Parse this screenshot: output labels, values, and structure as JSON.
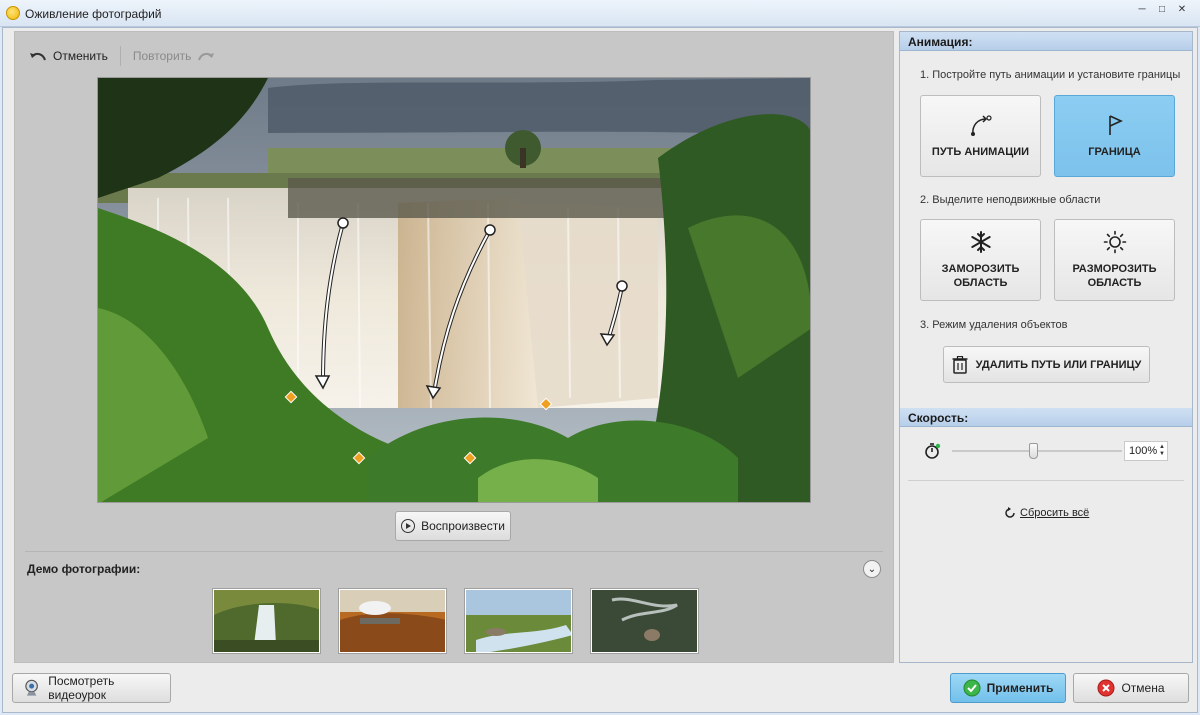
{
  "window": {
    "title": "Оживление фотографий",
    "controls": [
      "minimize-icon",
      "maximize-icon",
      "close-icon"
    ]
  },
  "toolbar": {
    "undo_label": "Отменить",
    "redo_label": "Повторить"
  },
  "player": {
    "play_label": "Воспроизвести"
  },
  "demo": {
    "label": "Демо фотографии:",
    "thumbnails": [
      "waterfall-thumbnail",
      "train-bridge-thumbnail",
      "river-thumbnail",
      "smoke-thumbnail"
    ]
  },
  "animation": {
    "header": "Анимация:",
    "step1": "1. Постройте путь анимации и установите границы",
    "path_button": "ПУТЬ АНИМАЦИИ",
    "border_button": "ГРАНИЦА",
    "step2": "2. Выделите неподвижные области",
    "freeze_button": "ЗАМОРОЗИТЬ ОБЛАСТЬ",
    "unfreeze_button": "РАЗМОРОЗИТЬ ОБЛАСТЬ",
    "step3": "3. Режим удаления объектов",
    "delete_button": "УДАЛИТЬ ПУТЬ ИЛИ ГРАНИЦУ",
    "active_tool": "border"
  },
  "speed": {
    "header": "Скорость:",
    "value": "100%",
    "reset_label": "Сбросить всё"
  },
  "footer": {
    "video_label": "Посмотреть видеоурок",
    "apply_label": "Применить",
    "cancel_label": "Отмена"
  },
  "colors": {
    "accent": "#7cc2ec",
    "header_bg": "#b7cfea",
    "marker": "#f0a020"
  }
}
